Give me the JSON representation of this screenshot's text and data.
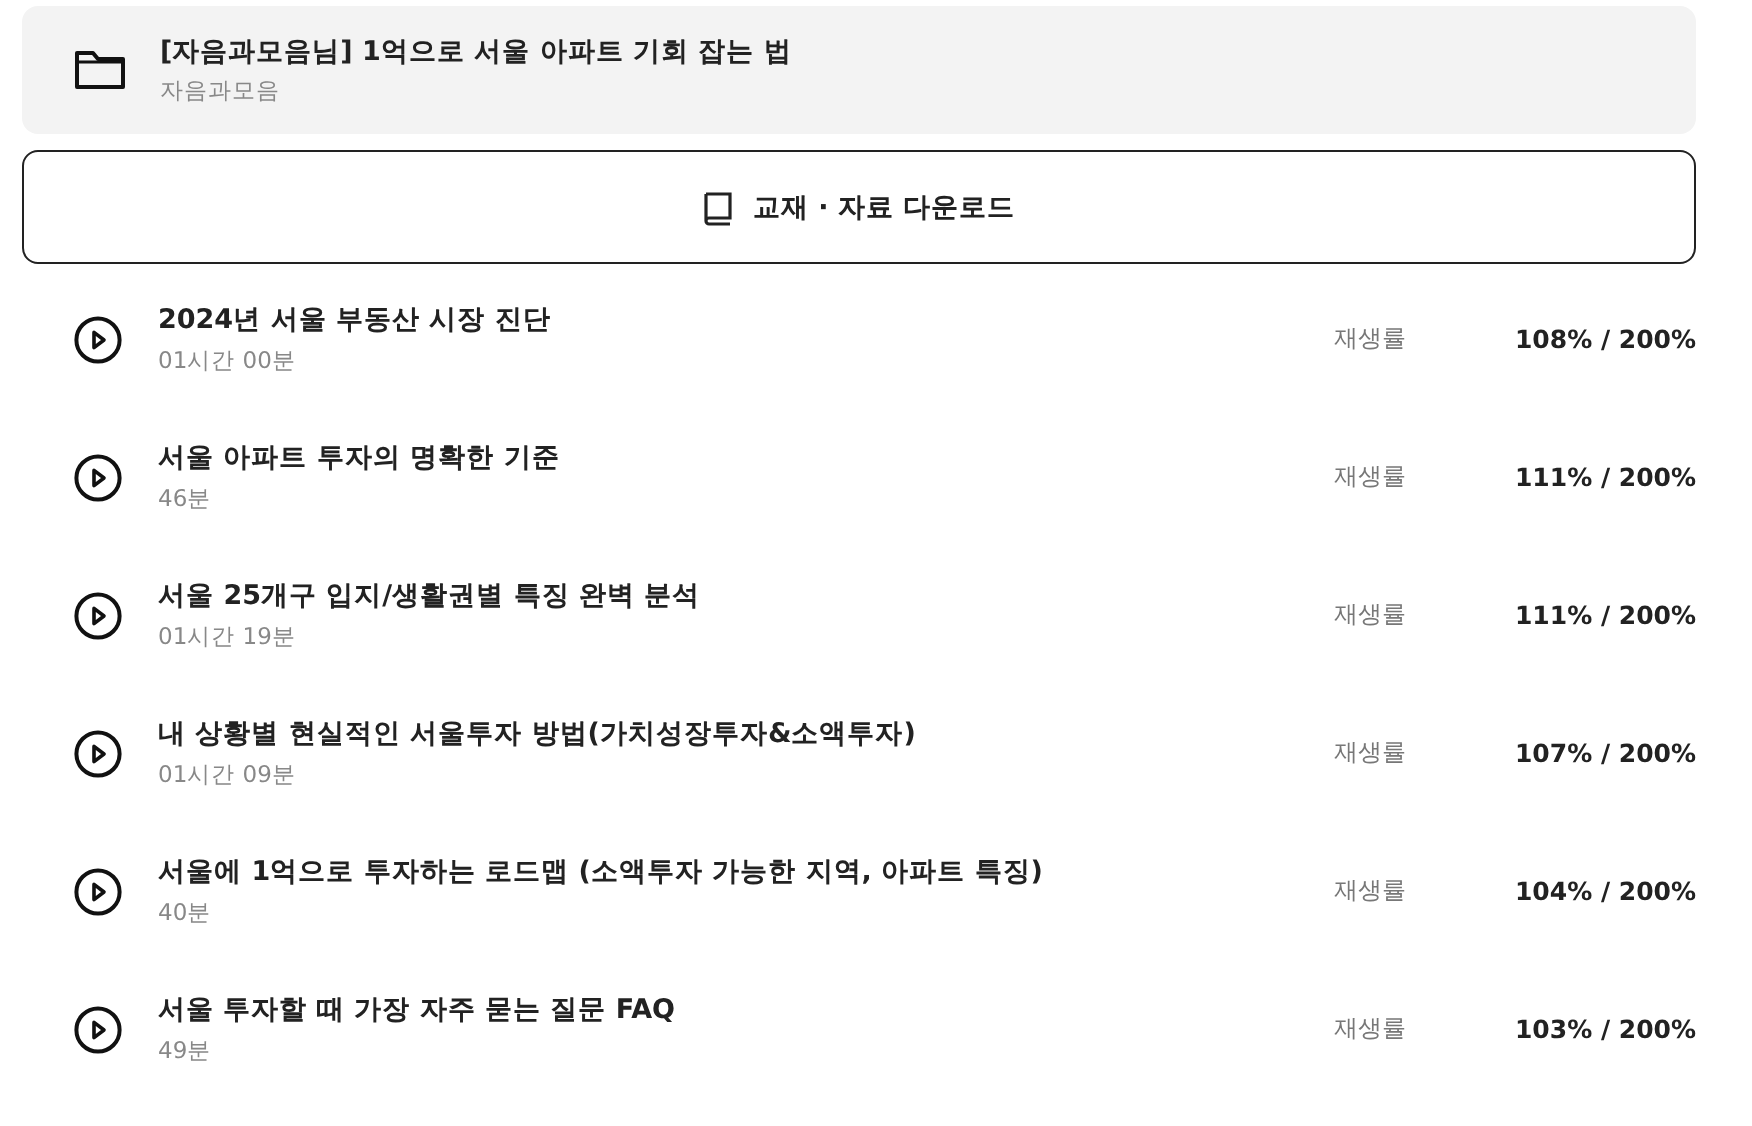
{
  "course": {
    "title": "[자음과모음님] 1억으로 서울 아파트 기회 잡는 법",
    "author": "자음과모음"
  },
  "download_button": {
    "label": "교재 · 자료 다운로드"
  },
  "lessons": [
    {
      "title": "2024년 서울 부동산 시장 진단",
      "duration": "01시간 00분",
      "rate_label": "재생률",
      "rate": "108% / 200%"
    },
    {
      "title": "서울 아파트 투자의 명확한 기준",
      "duration": "46분",
      "rate_label": "재생률",
      "rate": "111% / 200%"
    },
    {
      "title": "서울 25개구 입지/생활권별 특징 완벽 분석",
      "duration": "01시간 19분",
      "rate_label": "재생률",
      "rate": "111% / 200%"
    },
    {
      "title": "내 상황별 현실적인 서울투자 방법(가치성장투자&소액투자)",
      "duration": "01시간 09분",
      "rate_label": "재생률",
      "rate": "107% / 200%"
    },
    {
      "title": "서울에 1억으로 투자하는 로드맵 (소액투자 가능한 지역, 아파트 특징)",
      "duration": "40분",
      "rate_label": "재생률",
      "rate": "104% / 200%"
    },
    {
      "title": "서울 투자할 때 가장 자주 묻는 질문 FAQ",
      "duration": "49분",
      "rate_label": "재생률",
      "rate": "103% / 200%"
    }
  ]
}
